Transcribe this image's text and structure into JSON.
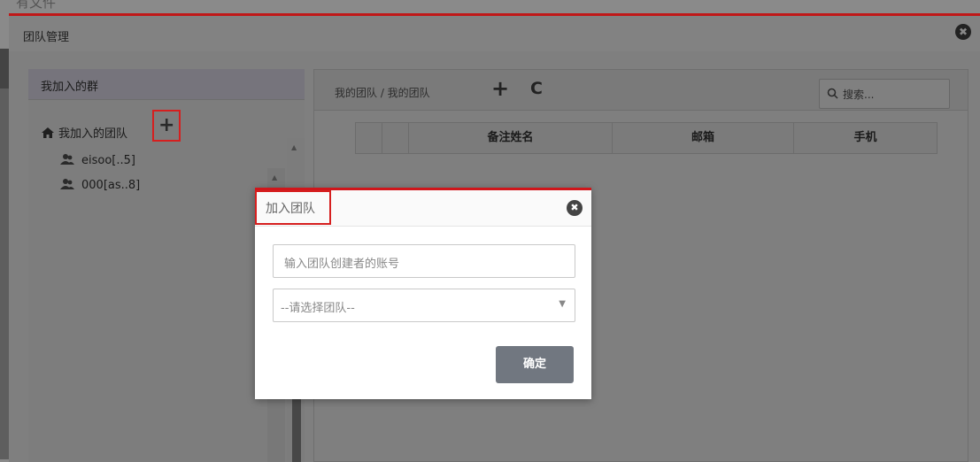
{
  "background": {
    "title_text": "有文件"
  },
  "window": {
    "title": "团队管理",
    "close_symbol": "✖"
  },
  "left_panel": {
    "header": "我加入的群",
    "tree_root_label": "我加入的团队",
    "add_symbol": "+",
    "items": [
      {
        "label": "eisoo[..5]",
        "icon": "user-icon"
      },
      {
        "label": "000[as..8]",
        "icon": "user-icon"
      }
    ]
  },
  "right_panel": {
    "breadcrumb": "我的团队 / 我的团队",
    "add_symbol": "+",
    "refresh_symbol": "C",
    "search_placeholder": "搜索...",
    "columns": [
      "",
      "",
      "备注姓名",
      "邮箱",
      "手机"
    ]
  },
  "dialog": {
    "title": "加入团队",
    "close_symbol": "✖",
    "account_placeholder": "输入团队创建者的账号",
    "select_placeholder": "--请选择团队--",
    "confirm_label": "确定"
  },
  "colors": {
    "accent_red": "#d0161b",
    "confirm_button": "#717780"
  }
}
